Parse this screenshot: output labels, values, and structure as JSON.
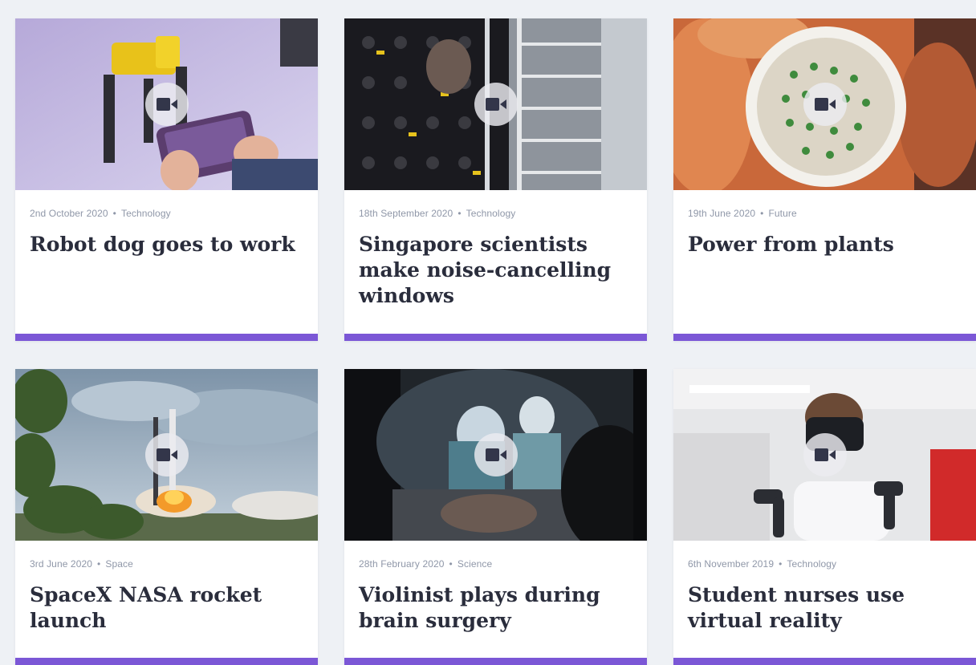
{
  "colors": {
    "accent": "#7b57d6",
    "page_background": "#eef1f5",
    "meta_text": "#8f97a8",
    "title_text": "#2a2d3c"
  },
  "cards": [
    {
      "date": "2nd October 2020",
      "category": "Technology",
      "title": "Robot dog goes to work",
      "icon": "video-camera-icon"
    },
    {
      "date": "18th September 2020",
      "category": "Technology",
      "title": "Singapore scientists make noise-cancelling windows",
      "icon": "video-camera-icon"
    },
    {
      "date": "19th June 2020",
      "category": "Future",
      "title": "Power from plants",
      "icon": "video-camera-icon"
    },
    {
      "date": "3rd June 2020",
      "category": "Space",
      "title": "SpaceX NASA rocket launch",
      "icon": "video-camera-icon"
    },
    {
      "date": "28th February 2020",
      "category": "Science",
      "title": "Violinist plays during brain surgery",
      "icon": "video-camera-icon"
    },
    {
      "date": "6th November 2019",
      "category": "Technology",
      "title": "Student nurses use virtual reality",
      "icon": "video-camera-icon"
    }
  ]
}
